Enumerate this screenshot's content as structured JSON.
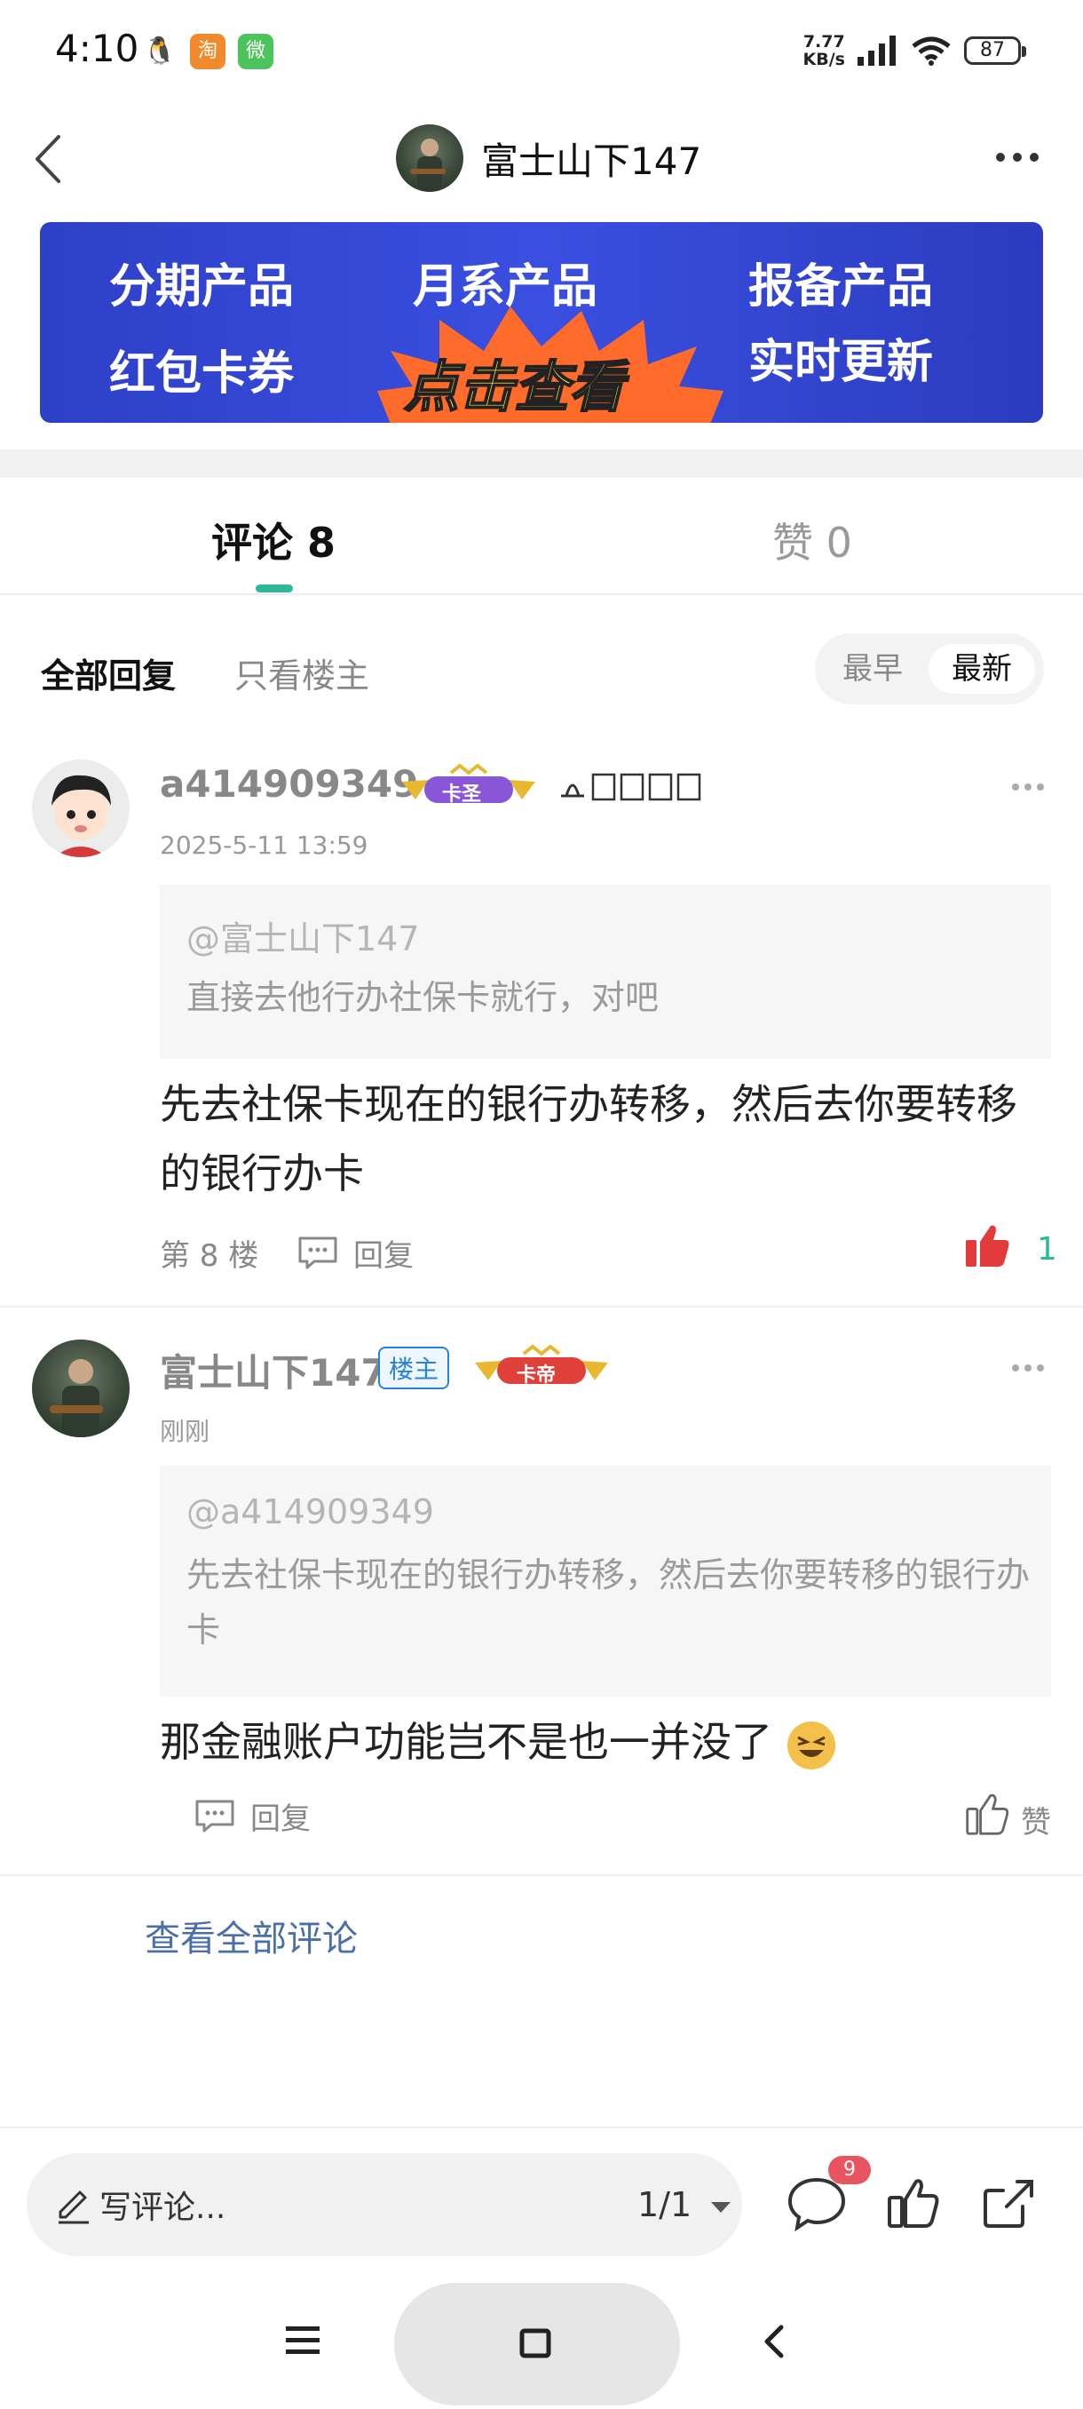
{
  "status_bar": {
    "time": "4:10",
    "apps": [
      "QQ",
      "淘",
      "微"
    ],
    "net_speed_value": "7.77",
    "net_speed_unit": "KB/s",
    "battery": "87"
  },
  "header": {
    "title": "富士山下147"
  },
  "banner": {
    "item1": "分期产品",
    "item2": "月系产品",
    "item3": "报备产品",
    "item4": "红包卡券",
    "item5": "实时更新",
    "cta": "点击查看"
  },
  "tabs": {
    "comments_label": "评论 8",
    "likes_label": "赞 0"
  },
  "filters": {
    "all": "全部回复",
    "op_only": "只看楼主",
    "sort_earliest": "最早",
    "sort_latest": "最新"
  },
  "comments": [
    {
      "username": "a414909349",
      "badge": "卡圣",
      "time": "2025-5-11 13:59",
      "quote_at": "@富士山下147",
      "quote_text": "直接去他行办社保卡就行，对吧",
      "body": "先去社保卡现在的银行办转移，然后去你要转移的银行办卡",
      "floor": "第 8 楼",
      "reply_label": "回复",
      "like_count": "1"
    },
    {
      "username": "富士山下147",
      "owner_badge": "楼主",
      "badge": "卡帝",
      "time": "刚刚",
      "quote_at": "@a414909349",
      "quote_text": "先去社保卡现在的银行办转移，然后去你要转移的银行办卡",
      "body": "那金融账户功能岂不是也一并没了",
      "reply_label": "回复",
      "like_label": "赞"
    }
  ],
  "view_all": "查看全部评论",
  "bottom_bar": {
    "placeholder": "写评论...",
    "page": "1/1",
    "notif_count": "9"
  },
  "colors": {
    "accent": "#2bb99a",
    "banner_blue": "#3a4fe0",
    "like_red": "#e23b3b",
    "link_blue": "#4a6fa8"
  }
}
